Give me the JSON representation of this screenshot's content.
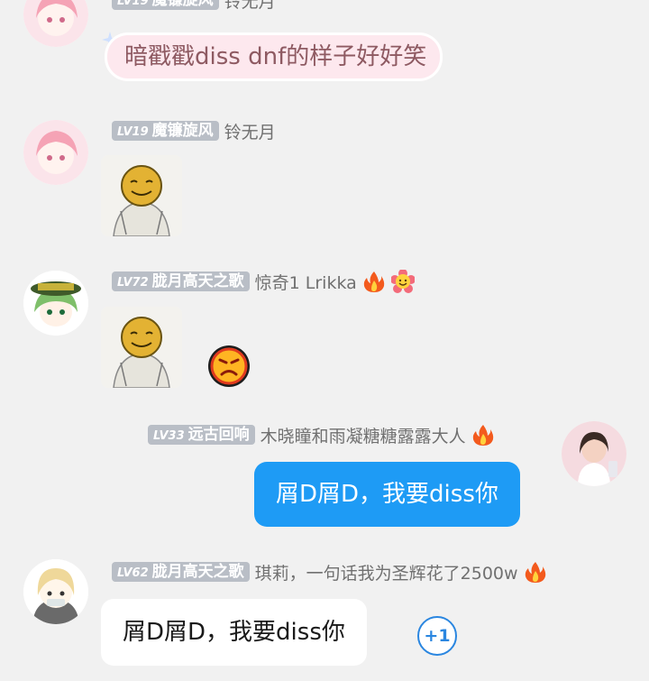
{
  "messages": [
    {
      "badge_level": "LV19",
      "badge_title": "魔镰旋风",
      "nickname": "铃无月",
      "text": "暗戳戳diss dnf的样子好好笑"
    },
    {
      "badge_level": "LV19",
      "badge_title": "魔镰旋风",
      "nickname": "铃无月"
    },
    {
      "badge_level": "LV72",
      "badge_title": "胧月高天之歌",
      "nickname": "惊奇1 Lrikka",
      "reaction_icon": "angry-face-reaction-icon"
    },
    {
      "badge_level": "LV33",
      "badge_title": "远古回响",
      "nickname": "木晓瞳和雨凝糖糖露露大人",
      "text": "屑D屑D，我要diss你"
    },
    {
      "badge_level": "LV62",
      "badge_title": "胧月高天之歌",
      "nickname": "琪莉，一句话我为圣辉花了2500w",
      "text": "屑D屑D，我要diss你",
      "plus_one": "+1"
    }
  ],
  "colors": {
    "background": "#f1f1f1",
    "badge": "#b9bec6",
    "self_bubble": "#1e9bf5",
    "pink_bubble": "#fde8ee",
    "pink_text": "#8e5a62",
    "plus_one": "#2a86e0"
  }
}
